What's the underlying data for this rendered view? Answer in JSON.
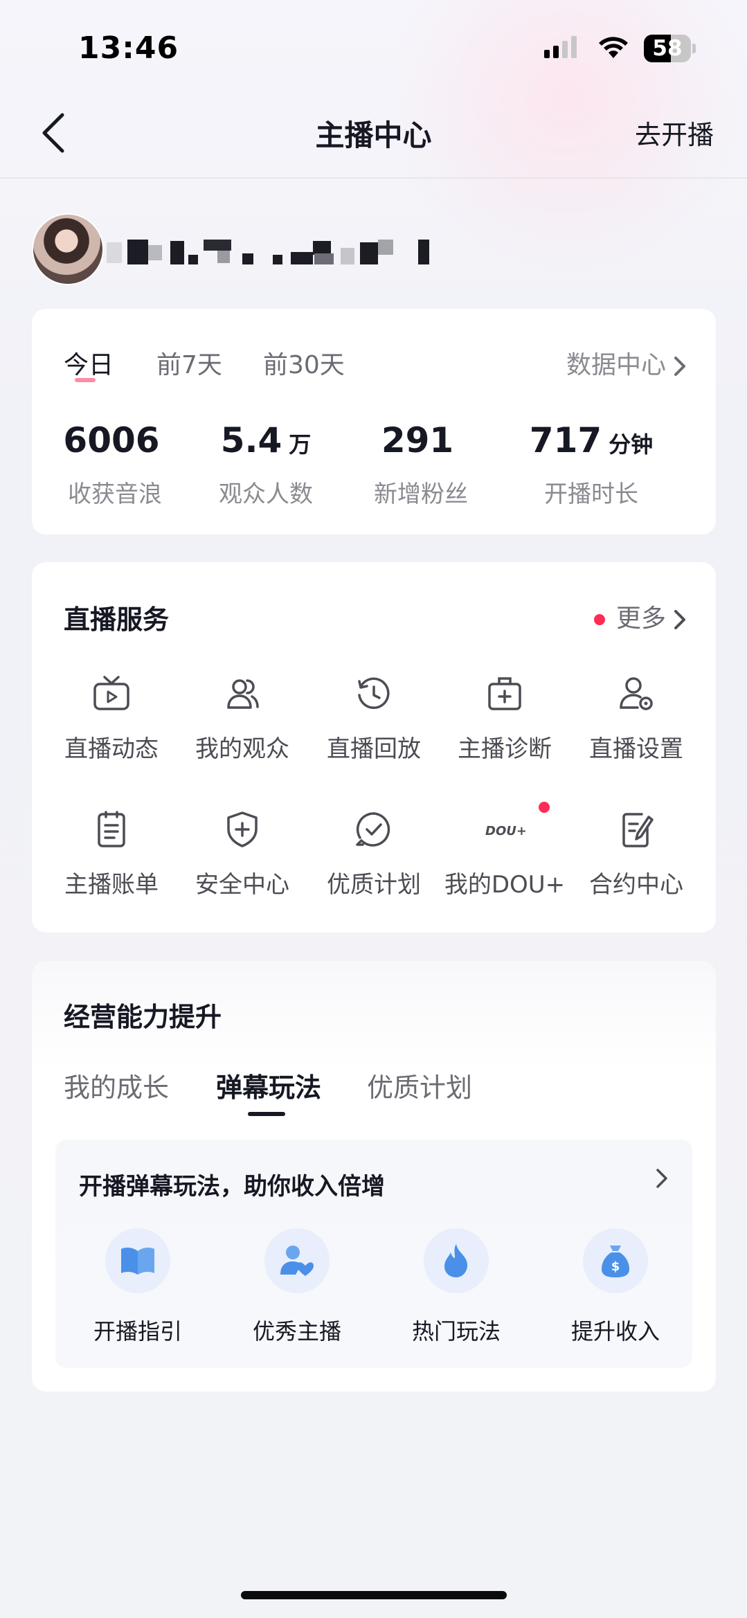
{
  "status_bar": {
    "time": "13:46",
    "battery_level": "58",
    "battery_fraction": 0.58
  },
  "nav": {
    "title": "主播中心",
    "go_live": "去开播"
  },
  "stats": {
    "tabs": [
      "今日",
      "前7天",
      "前30天"
    ],
    "active_tab": 0,
    "data_center": "数据中心",
    "items": [
      {
        "value": "6006",
        "unit": "",
        "label": "收获音浪"
      },
      {
        "value": "5.4",
        "unit": "万",
        "label": "观众人数"
      },
      {
        "value": "291",
        "unit": "",
        "label": "新增粉丝"
      },
      {
        "value": "717",
        "unit": "分钟",
        "label": "开播时长"
      }
    ]
  },
  "services": {
    "title": "直播服务",
    "more": "更多",
    "items": [
      {
        "label": "直播动态",
        "icon": "tv-play-icon"
      },
      {
        "label": "我的观众",
        "icon": "audience-icon"
      },
      {
        "label": "直播回放",
        "icon": "history-icon"
      },
      {
        "label": "主播诊断",
        "icon": "medical-kit-icon"
      },
      {
        "label": "直播设置",
        "icon": "user-settings-icon"
      },
      {
        "label": "主播账单",
        "icon": "clipboard-icon"
      },
      {
        "label": "安全中心",
        "icon": "shield-plus-icon"
      },
      {
        "label": "优质计划",
        "icon": "check-circle-icon"
      },
      {
        "label": "我的DOU+",
        "icon": "dou-plus-icon",
        "icon_text": "DOU+"
      },
      {
        "label": "合约中心",
        "icon": "contract-edit-icon"
      }
    ]
  },
  "ability": {
    "title": "经营能力提升",
    "tabs": [
      "我的成长",
      "弹幕玩法",
      "优质计划"
    ],
    "active_tab": 1,
    "promo_title": "开播弹幕玩法，助你收入倍增",
    "promo_items": [
      {
        "label": "开播指引",
        "icon": "book-icon"
      },
      {
        "label": "优秀主播",
        "icon": "user-heart-icon"
      },
      {
        "label": "热门玩法",
        "icon": "flame-icon"
      },
      {
        "label": "提升收入",
        "icon": "money-bag-icon"
      }
    ]
  },
  "colors": {
    "accent": "#fe2c55",
    "icon_blue": "#4a90e8"
  }
}
